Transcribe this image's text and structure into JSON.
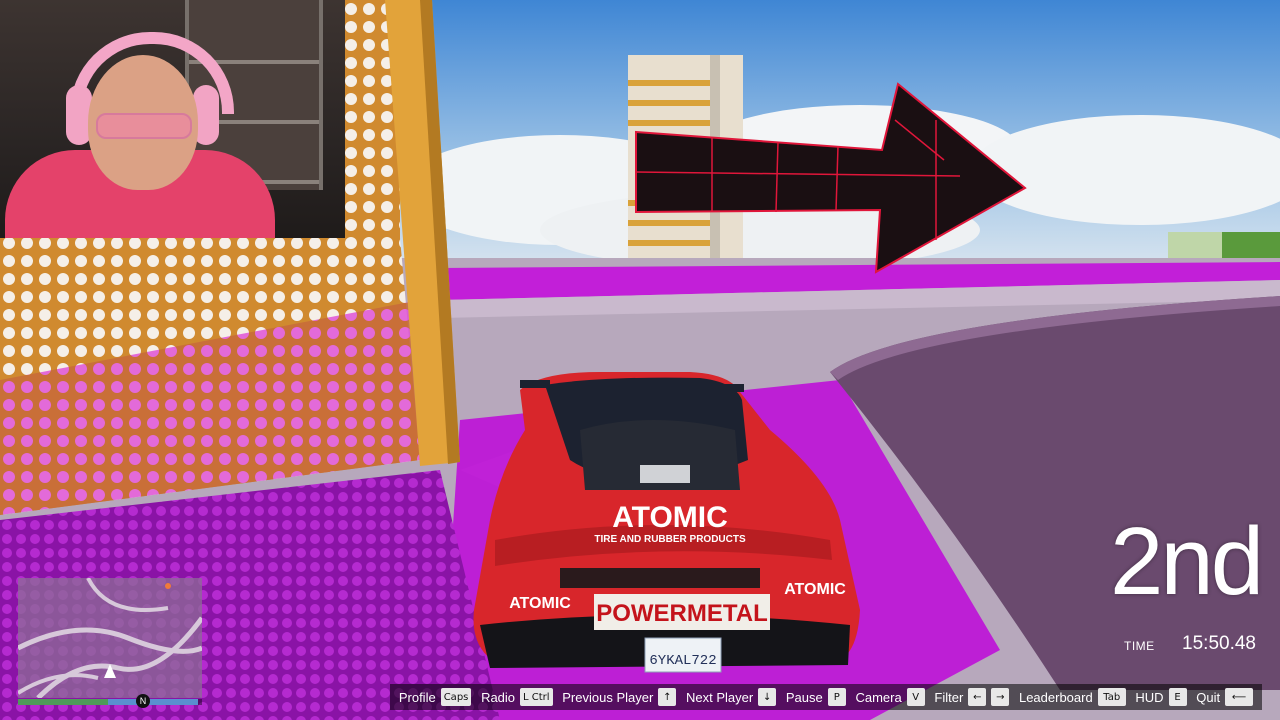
{
  "race": {
    "position": "2nd",
    "time_label": "TIME",
    "time_value": "15:50.48"
  },
  "vehicle": {
    "livery_brand": "ATOMIC",
    "livery_sub": "TIRE AND RUBBER PRODUCTS",
    "bumper_brand": "POWERMETAL",
    "plate": "6YKAL722"
  },
  "minimap": {
    "north_marker": "N",
    "health": 0.49,
    "armor": 0.49,
    "health_color": "#4f9a5a",
    "armor_color": "#5a8fcf"
  },
  "controls": [
    {
      "label": "Profile",
      "key": "Caps",
      "icon": "caps-key"
    },
    {
      "label": "Radio",
      "key": "L Ctrl",
      "icon": "ctrl-key"
    },
    {
      "label": "Previous Player",
      "key": "↑",
      "icon": "arrow-up-icon"
    },
    {
      "label": "Next Player",
      "key": "↓",
      "icon": "arrow-down-icon"
    },
    {
      "label": "Pause",
      "key": "P",
      "icon": "p-key"
    },
    {
      "label": "Camera",
      "key": "V",
      "icon": "v-key"
    },
    {
      "label": "Filter",
      "key": "←",
      "key2": "→",
      "icon": "arrow-left-right-icon"
    },
    {
      "label": "Leaderboard",
      "key": "Tab",
      "icon": "tab-key"
    },
    {
      "label": "HUD",
      "key": "E",
      "icon": "e-key"
    },
    {
      "label": "Quit",
      "key": "⟵",
      "icon": "backspace-icon"
    }
  ],
  "colors": {
    "track_magenta": "#c21fd8",
    "arrow_black": "#1a0f12",
    "arrow_outline": "#e0163a",
    "car_red": "#d8262b"
  }
}
